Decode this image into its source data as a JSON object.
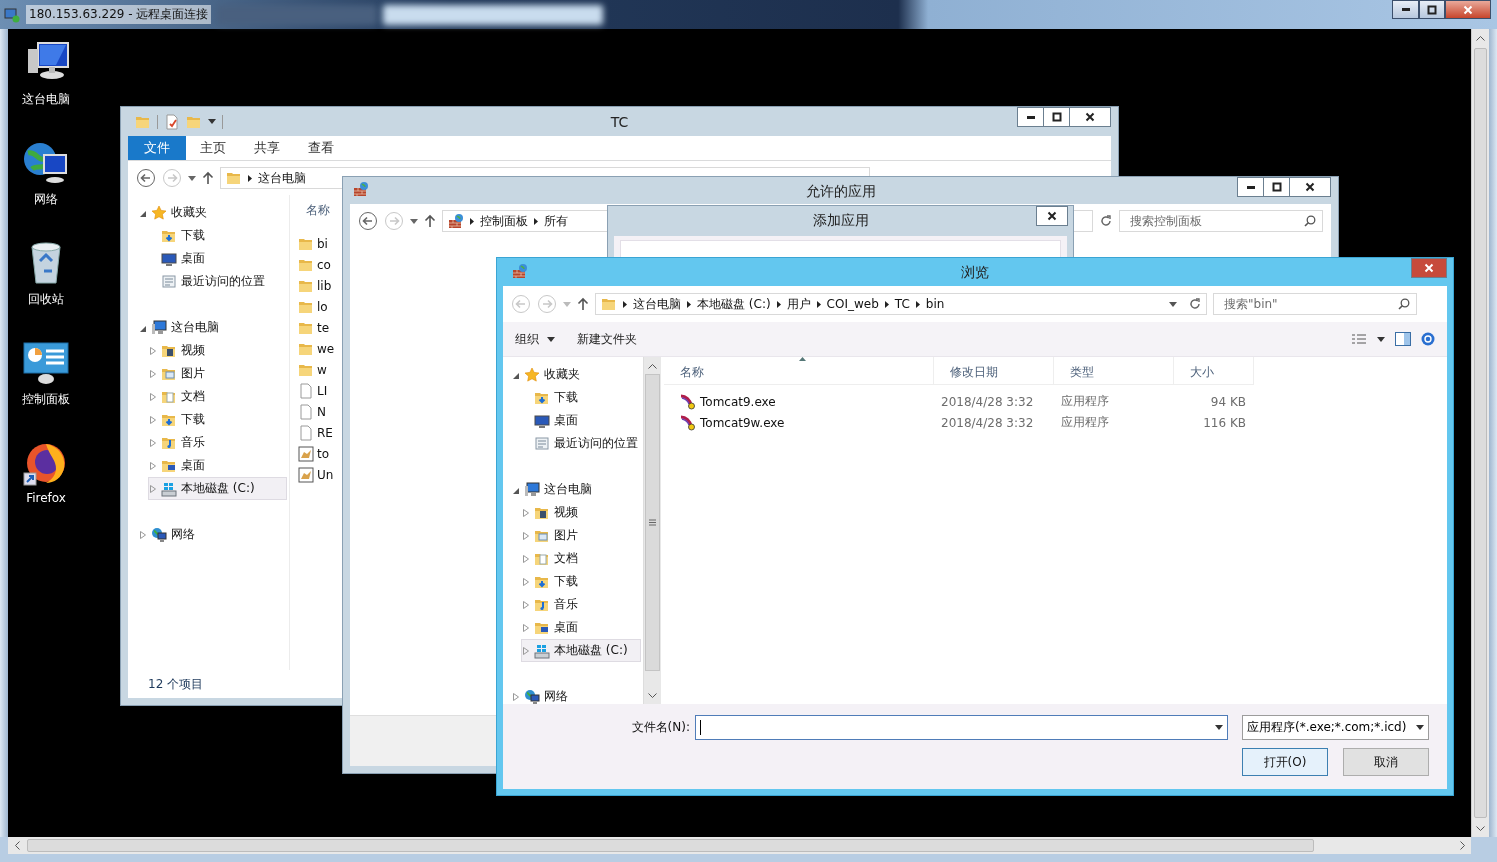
{
  "remote_desktop": {
    "title": "180.153.63.229 - 远程桌面连接"
  },
  "desktop_icons": [
    {
      "label": "这台电脑",
      "kind": "computer"
    },
    {
      "label": "网络",
      "kind": "network"
    },
    {
      "label": "回收站",
      "kind": "recycle"
    },
    {
      "label": "控制面板",
      "kind": "control"
    },
    {
      "label": "Firefox",
      "kind": "firefox"
    }
  ],
  "tc_window": {
    "title": "TC",
    "ribbon_tabs": [
      {
        "label": "文件",
        "selected": true
      },
      {
        "label": "主页",
        "selected": false
      },
      {
        "label": "共享",
        "selected": false
      },
      {
        "label": "查看",
        "selected": false
      }
    ],
    "breadcrumb": [
      "这台电脑"
    ],
    "nav_tree": [
      {
        "label": "收藏夹",
        "kind": "star",
        "expanded": true,
        "selected": false,
        "children": [
          {
            "label": "下载",
            "kind": "download",
            "selected": false
          },
          {
            "label": "桌面",
            "kind": "desktop",
            "selected": false
          },
          {
            "label": "最近访问的位置",
            "kind": "recent",
            "selected": false
          }
        ]
      },
      {
        "label": "这台电脑",
        "kind": "pc",
        "expanded": true,
        "selected": false,
        "children": [
          {
            "label": "视频",
            "kind": "video",
            "expanded": false,
            "selected": false
          },
          {
            "label": "图片",
            "kind": "picture",
            "expanded": false,
            "selected": false
          },
          {
            "label": "文档",
            "kind": "doc",
            "expanded": false,
            "selected": false
          },
          {
            "label": "下载",
            "kind": "download",
            "expanded": false,
            "selected": false
          },
          {
            "label": "音乐",
            "kind": "music",
            "expanded": false,
            "selected": false
          },
          {
            "label": "桌面",
            "kind": "deskfolder",
            "expanded": false,
            "selected": false
          },
          {
            "label": "本地磁盘 (C:)",
            "kind": "drive",
            "expanded": false,
            "selected": true
          }
        ]
      },
      {
        "label": "网络",
        "kind": "network",
        "expanded": false,
        "selected": false
      }
    ],
    "column_header": "名称",
    "files": [
      {
        "name": "bi",
        "kind": "folder"
      },
      {
        "name": "co",
        "kind": "folder"
      },
      {
        "name": "lib",
        "kind": "folder"
      },
      {
        "name": "lo",
        "kind": "folder"
      },
      {
        "name": "te",
        "kind": "folder"
      },
      {
        "name": "we",
        "kind": "folder"
      },
      {
        "name": "w",
        "kind": "folder"
      },
      {
        "name": "LI",
        "kind": "file"
      },
      {
        "name": "N",
        "kind": "file"
      },
      {
        "name": "RE",
        "kind": "file"
      },
      {
        "name": "to",
        "kind": "app"
      },
      {
        "name": "Un",
        "kind": "app"
      }
    ],
    "status": "12 个项目"
  },
  "apps_window": {
    "title": "允许的应用",
    "breadcrumb": [
      "控制面板",
      "所有"
    ],
    "search": {
      "placeholder": "搜索控制面板"
    }
  },
  "add_dialog": {
    "title": "添加应用"
  },
  "browse_dialog": {
    "title": "浏览",
    "breadcrumb": [
      "这台电脑",
      "本地磁盘 (C:)",
      "用户",
      "COI_web",
      "TC",
      "bin"
    ],
    "search": {
      "placeholder": "搜索\"bin\""
    },
    "toolbar": [
      {
        "label": "组织",
        "kind": "menu"
      },
      {
        "label": "新建文件夹",
        "kind": "button"
      }
    ],
    "nav_tree": [
      {
        "label": "收藏夹",
        "kind": "star",
        "expanded": true,
        "selected": false,
        "children": [
          {
            "label": "下载",
            "kind": "download",
            "selected": false
          },
          {
            "label": "桌面",
            "kind": "desktop",
            "selected": false
          },
          {
            "label": "最近访问的位置",
            "kind": "recent",
            "selected": false
          }
        ]
      },
      {
        "label": "这台电脑",
        "kind": "pc",
        "expanded": true,
        "selected": false,
        "children": [
          {
            "label": "视频",
            "kind": "video",
            "expanded": false,
            "selected": false
          },
          {
            "label": "图片",
            "kind": "picture",
            "expanded": false,
            "selected": false
          },
          {
            "label": "文档",
            "kind": "doc",
            "expanded": false,
            "selected": false
          },
          {
            "label": "下载",
            "kind": "download",
            "expanded": false,
            "selected": false
          },
          {
            "label": "音乐",
            "kind": "music",
            "expanded": false,
            "selected": false
          },
          {
            "label": "桌面",
            "kind": "deskfolder",
            "expanded": false,
            "selected": false
          },
          {
            "label": "本地磁盘 (C:)",
            "kind": "drive",
            "expanded": false,
            "selected": true
          }
        ]
      },
      {
        "label": "网络",
        "kind": "network",
        "expanded": false,
        "selected": false
      }
    ],
    "columns": [
      {
        "label": "名称",
        "sorted": true
      },
      {
        "label": "修改日期",
        "sorted": false
      },
      {
        "label": "类型",
        "sorted": false
      },
      {
        "label": "大小",
        "sorted": false
      }
    ],
    "rows": [
      {
        "name": "Tomcat9.exe",
        "date": "2018/4/28 3:32",
        "type": "应用程序",
        "size": "94 KB",
        "selected": false
      },
      {
        "name": "Tomcat9w.exe",
        "date": "2018/4/28 3:32",
        "type": "应用程序",
        "size": "116 KB",
        "selected": false
      }
    ],
    "file_name": {
      "label": "文件名(N):"
    },
    "filter": "应用程序(*.exe;*.com;*.icd)",
    "buttons": [
      {
        "label": "打开(O)",
        "default": true
      },
      {
        "label": "取消",
        "default": false
      }
    ]
  }
}
